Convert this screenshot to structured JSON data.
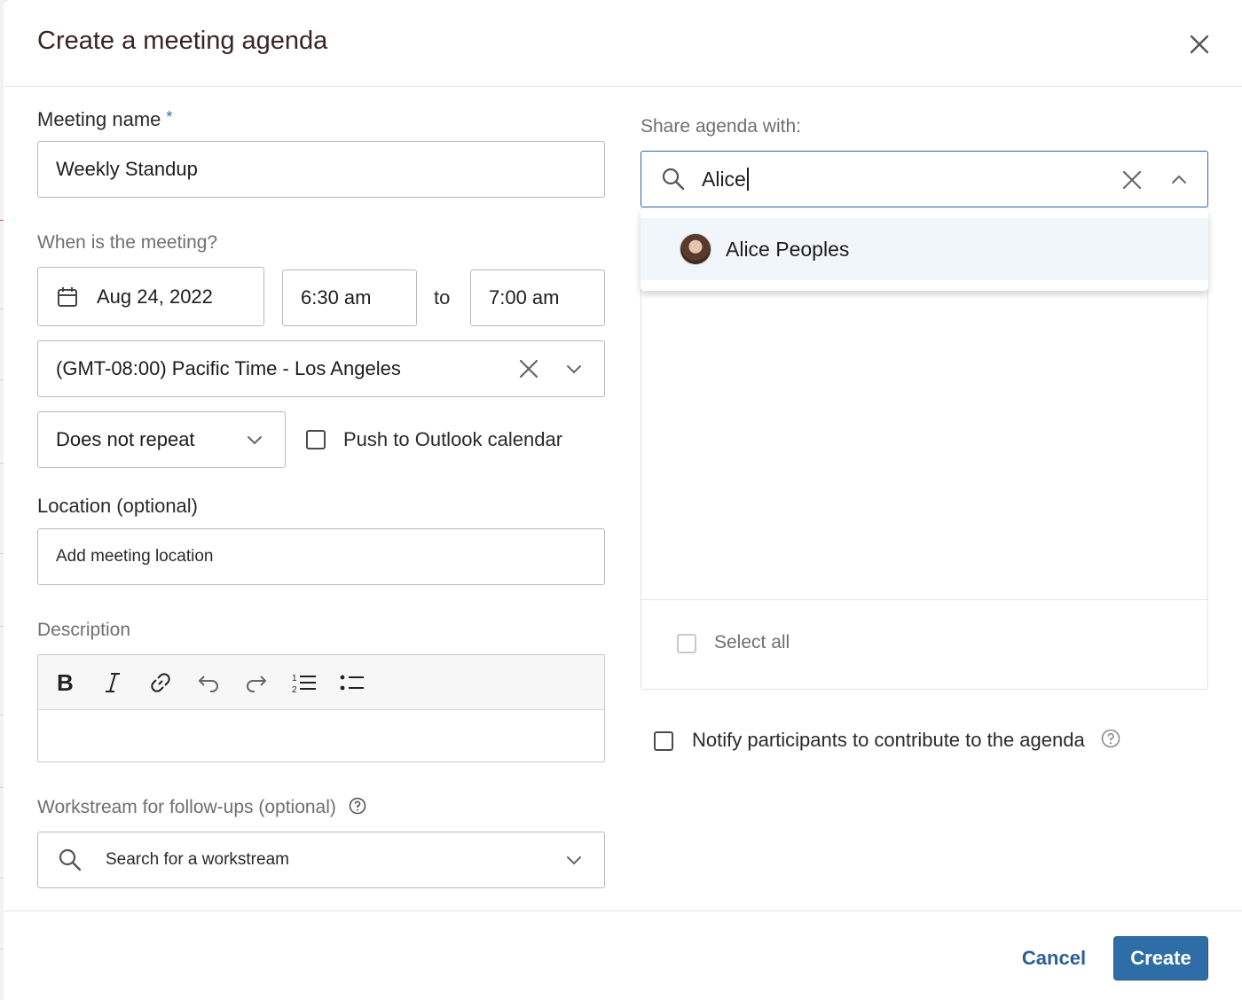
{
  "dialog": {
    "title": "Create a meeting agenda"
  },
  "form": {
    "meeting_name_label": "Meeting name",
    "required_marker": "*",
    "meeting_name_value": "Weekly Standup",
    "when_label": "When is the meeting?",
    "date_value": "Aug 24, 2022",
    "start_time": "6:30 am",
    "to_label": "to",
    "end_time": "7:00 am",
    "timezone_value": "(GMT-08:00) Pacific Time - Los Angeles",
    "repeat_value": "Does not repeat",
    "push_outlook_label": "Push to Outlook calendar",
    "location_label": "Location (optional)",
    "location_placeholder": "Add meeting location",
    "description_label": "Description",
    "workstream_label": "Workstream for follow-ups (optional)",
    "workstream_placeholder": "Search for a workstream"
  },
  "share": {
    "label": "Share agenda with:",
    "search_value": "Alice",
    "results": [
      {
        "name": "Alice Peoples"
      }
    ],
    "select_all_label": "Select all",
    "notify_label": "Notify participants to contribute to the agenda"
  },
  "toolbar_icons": [
    "bold-icon",
    "italic-icon",
    "link-icon",
    "undo-icon",
    "redo-icon",
    "numbered-list-icon",
    "bulleted-list-icon"
  ],
  "footer": {
    "cancel_label": "Cancel",
    "create_label": "Create"
  },
  "colors": {
    "primary": "#2f6da6",
    "link": "#2b5f95",
    "focus_border": "#2b6aa6",
    "highlight_row": "#f0f6fa"
  }
}
